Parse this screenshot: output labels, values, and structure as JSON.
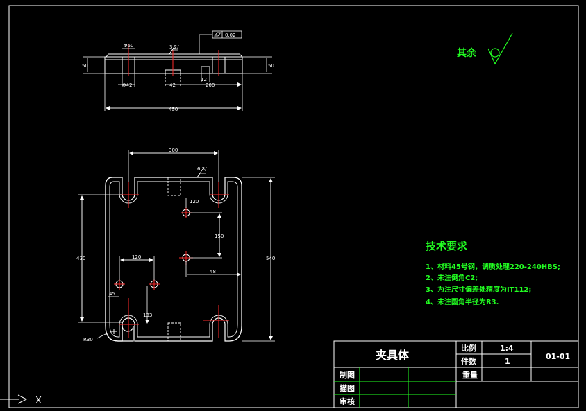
{
  "colors": {
    "background": "#000000",
    "outline": "#ffffff",
    "centerline": "#ff2a2a",
    "annotation": "#22ff22",
    "title_block": "#ffffff"
  },
  "front_view": {
    "dims": {
      "phi60": "Φ60",
      "phi42": "Φ42",
      "d42": "42",
      "d200": "200",
      "d450": "450",
      "d50_left": "50",
      "d50_right": "50",
      "d12": "12",
      "surface_finish": "3.2/",
      "flatness": "0.02"
    }
  },
  "plan_view": {
    "dims": {
      "d300": "300",
      "d120_top": "120",
      "d150": "150",
      "d120_mid": "120",
      "d48": "48",
      "d430": "430",
      "d540": "540",
      "d45": "45",
      "d133": "133",
      "r30": "R30",
      "finish_top": "6.3/"
    }
  },
  "rest_finish": {
    "label": "其余"
  },
  "tech_requirements": {
    "title": "技术要求",
    "items": [
      "1、材料45号钢，调质处理220-240HBS;",
      "2、未注倒角C2;",
      "3、为注尺寸偏差处精度为IT112;",
      "4、未注圆角半径为R3."
    ]
  },
  "title_block": {
    "part_name": "夹具体",
    "scale_label": "比例",
    "scale_value": "1:4",
    "qty_label": "件数",
    "qty_value": "1",
    "weight_label": "重量",
    "drawing_no": "01-01",
    "drawn_label": "制图",
    "traced_label": "描图",
    "checked_label": "审核"
  },
  "ucs": {
    "x_label": "X"
  }
}
